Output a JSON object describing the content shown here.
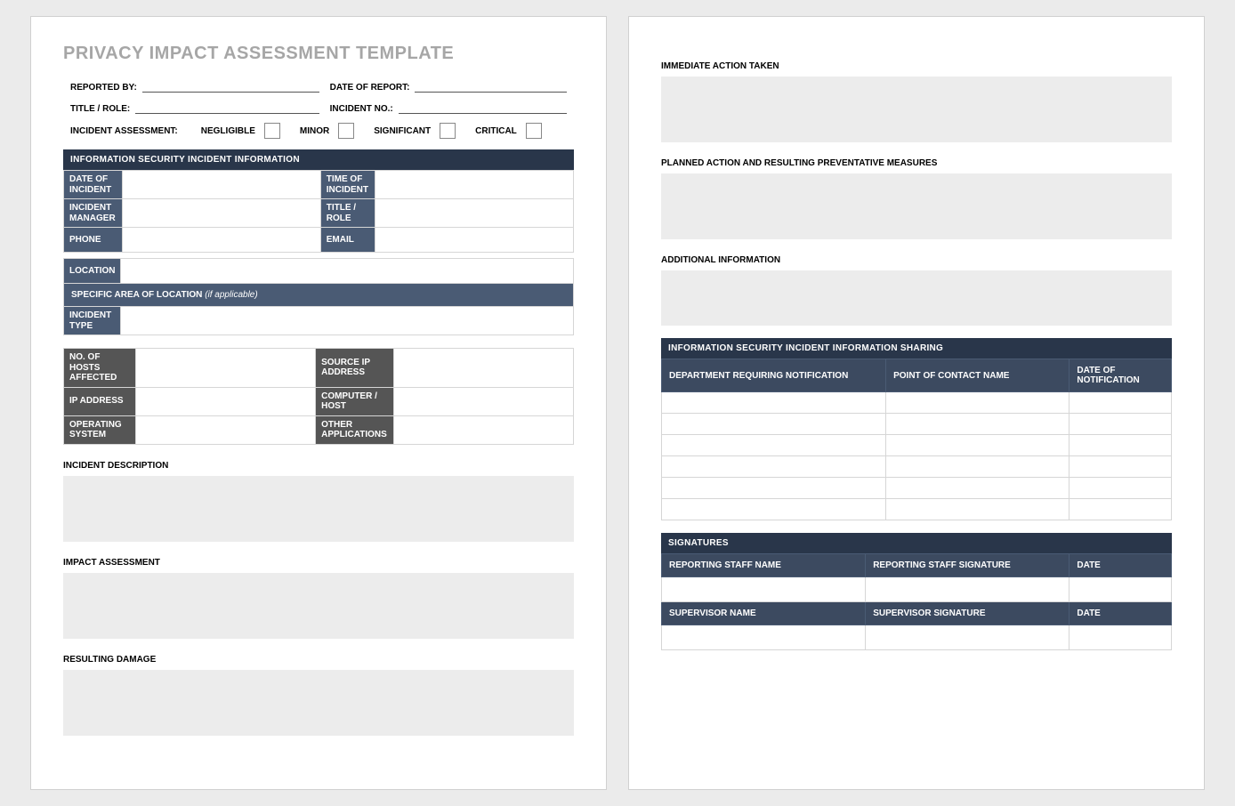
{
  "title": "PRIVACY IMPACT ASSESSMENT TEMPLATE",
  "header": {
    "reported_by": "REPORTED BY:",
    "date_of_report": "DATE OF REPORT:",
    "title_role": "TITLE / ROLE:",
    "incident_no": "INCIDENT NO.:",
    "assessment_label": "INCIDENT ASSESSMENT:",
    "levels": [
      "NEGLIGIBLE",
      "MINOR",
      "SIGNIFICANT",
      "CRITICAL"
    ]
  },
  "sec_info": {
    "header": "INFORMATION SECURITY INCIDENT INFORMATION",
    "rows": [
      [
        "DATE OF INCIDENT",
        "TIME OF INCIDENT"
      ],
      [
        "INCIDENT MANAGER",
        "TITLE / ROLE"
      ],
      [
        "PHONE",
        "EMAIL"
      ]
    ],
    "location": "LOCATION",
    "specific_area": "SPECIFIC AREA OF LOCATION",
    "specific_area_note": "(if applicable)",
    "incident_type": "INCIDENT TYPE"
  },
  "gray": {
    "rows": [
      [
        "NO. OF HOSTS AFFECTED",
        "SOURCE IP ADDRESS"
      ],
      [
        "IP ADDRESS",
        "COMPUTER / HOST"
      ],
      [
        "OPERATING SYSTEM",
        "OTHER APPLICATIONS"
      ]
    ]
  },
  "freetext": {
    "description": "INCIDENT DESCRIPTION",
    "impact": "IMPACT ASSESSMENT",
    "damage": "RESULTING DAMAGE",
    "immediate": "IMMEDIATE ACTION TAKEN",
    "planned": "PLANNED ACTION AND RESULTING PREVENTATIVE MEASURES",
    "additional": "ADDITIONAL INFORMATION"
  },
  "sharing": {
    "header": "INFORMATION SECURITY INCIDENT INFORMATION SHARING",
    "cols": [
      "DEPARTMENT REQUIRING NOTIFICATION",
      "POINT OF CONTACT NAME",
      "DATE OF NOTIFICATION"
    ],
    "rows": 6
  },
  "signatures": {
    "header": "SIGNATURES",
    "row1": [
      "REPORTING STAFF NAME",
      "REPORTING STAFF SIGNATURE",
      "DATE"
    ],
    "row2": [
      "SUPERVISOR NAME",
      "SUPERVISOR SIGNATURE",
      "DATE"
    ]
  }
}
